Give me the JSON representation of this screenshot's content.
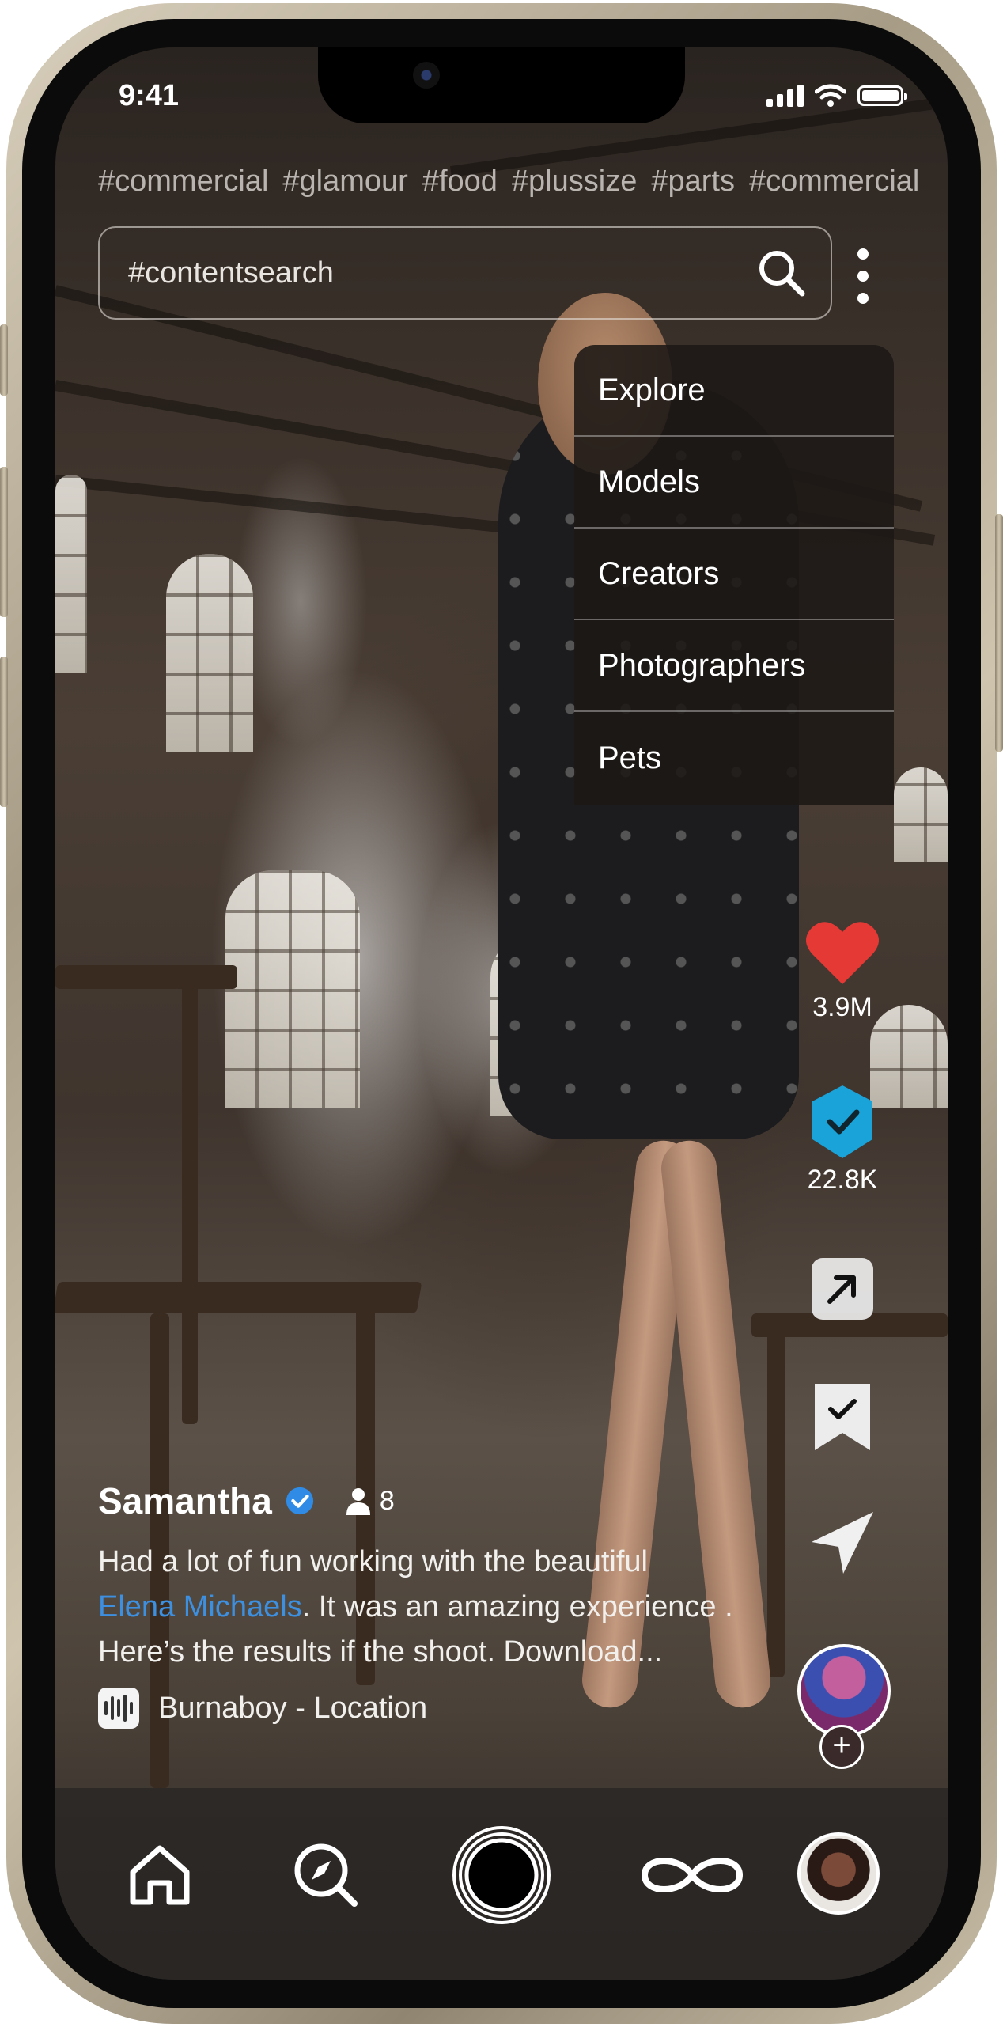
{
  "status_bar": {
    "time": "9:41"
  },
  "hashtags": [
    "#commercial",
    "#glamour",
    "#food",
    "#plussize",
    "#parts",
    "#commercial"
  ],
  "search": {
    "placeholder": "#contentsearch"
  },
  "menu": {
    "items": [
      "Explore",
      "Models",
      "Creators",
      "Photographers",
      "Pets"
    ]
  },
  "actions": {
    "likes": "3.9M",
    "verified_count": "22.8K",
    "colors": {
      "like": "#e53935",
      "verified": "#1aa3d9",
      "mention": "#3d8fe0"
    }
  },
  "post": {
    "username": "Samantha",
    "follower_count": "8",
    "description_pre": "Had a lot of fun working with the beautiful",
    "mention": "Elena Michaels",
    "description_post": ". It was an amazing experience . Here’s the results if the shoot. Download...",
    "music": "Burnaboy - Location"
  },
  "tab_bar": {
    "icons": [
      "home-icon",
      "explore-icon",
      "record-icon",
      "infinity-icon",
      "profile-avatar"
    ]
  }
}
